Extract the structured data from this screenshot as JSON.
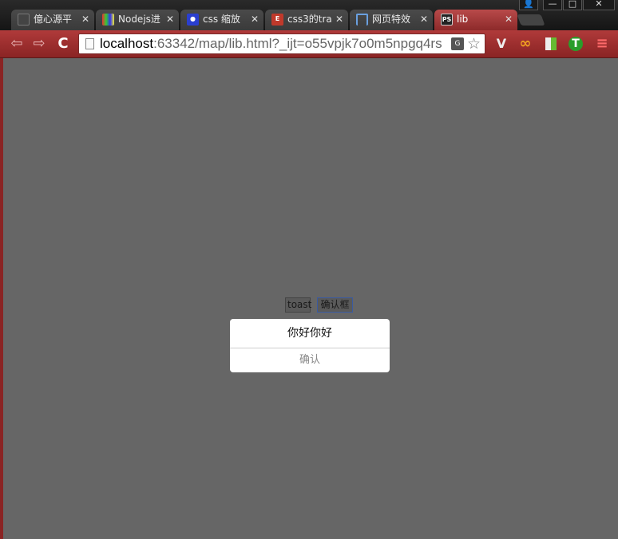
{
  "tabs": [
    {
      "title": "億心源平",
      "icon": "page-icon"
    },
    {
      "title": "Nodejs进",
      "icon": "nodejs-favicon-icon"
    },
    {
      "title": "css 缩放",
      "icon": "paw-icon"
    },
    {
      "title": "css3的tra",
      "icon": "e-logo-icon"
    },
    {
      "title": "网页特效",
      "icon": "frame-icon"
    },
    {
      "title": "lib",
      "icon": "ps-icon",
      "icon_text": "PS"
    }
  ],
  "tab_close": "✕",
  "window_controls": {
    "user": "👤",
    "minimize": "—",
    "maximize": "□",
    "close": "✕"
  },
  "address_bar": {
    "host": "localhost",
    "rest": ":63342/map/lib.html?_ijt=o55vpjk7o0m5npgq4rs"
  },
  "icons": {
    "back": "⇦",
    "forward": "⇨",
    "reload": "C",
    "star": "☆",
    "translate": "G",
    "vivaldi": "V",
    "infinity": "∞",
    "t_ext": "T",
    "menu": "≡"
  },
  "page": {
    "toast_button": "toast",
    "confirm_box_button": "确认框",
    "dialog_message": "你好你好",
    "dialog_confirm": "确认"
  },
  "colors": {
    "accent": "#8a2424",
    "viewport_bg": "#666666"
  }
}
